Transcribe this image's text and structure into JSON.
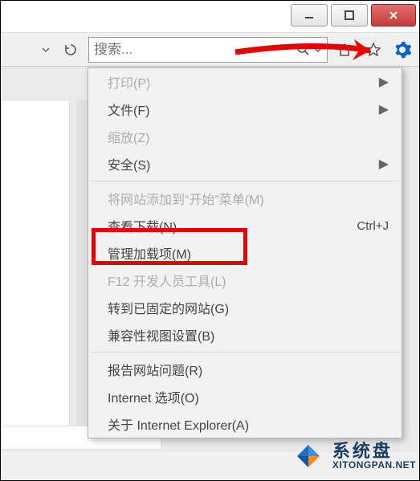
{
  "window": {
    "minimize": "minimize",
    "maximize": "maximize",
    "close": "close"
  },
  "toolbar": {
    "search_placeholder": "搜索..."
  },
  "menu": {
    "items": [
      {
        "label": "打印(P)",
        "disabled": true,
        "submenu": true
      },
      {
        "label": "文件(F)",
        "submenu": true
      },
      {
        "label": "缩放(Z)",
        "disabled": true,
        "submenu": false
      },
      {
        "label": "安全(S)",
        "submenu": true
      },
      {
        "sep": true
      },
      {
        "label": "将网站添加到“开始”菜单(M)",
        "disabled": true
      },
      {
        "label": "查看下载(N)",
        "shortcut": "Ctrl+J"
      },
      {
        "label": "管理加载项(M)",
        "highlight": true
      },
      {
        "label": "F12 开发人员工具(L)",
        "disabled": true
      },
      {
        "label": "转到已固定的网站(G)"
      },
      {
        "label": "兼容性视图设置(B)"
      },
      {
        "sep": true
      },
      {
        "label": "报告网站问题(R)"
      },
      {
        "label": "Internet 选项(O)"
      },
      {
        "label": "关于 Internet Explorer(A)"
      }
    ]
  },
  "watermark": {
    "cn": "系统盘",
    "en": "XITONGPAN.NET"
  },
  "annotation": {
    "arrow_color": "#e60000",
    "highlight_color": "#e60000"
  }
}
